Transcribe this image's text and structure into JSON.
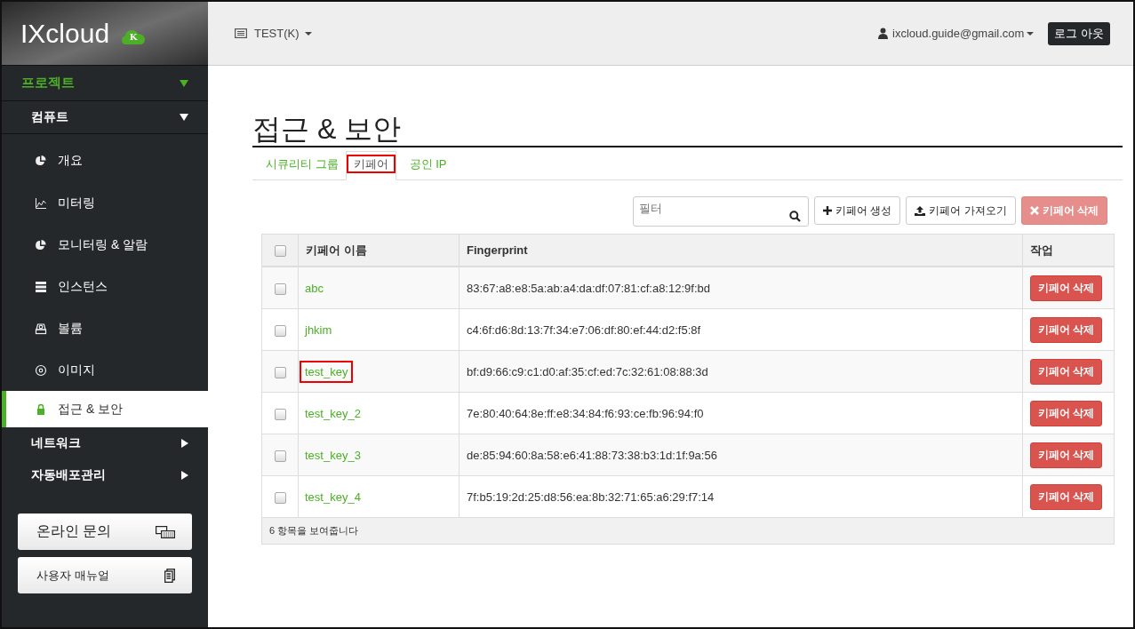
{
  "logo": {
    "text": "IXcloud",
    "badge": "K"
  },
  "header": {
    "project": "TEST(K)",
    "user": "ixcloud.guide@gmail.com",
    "logout": "로그 아웃"
  },
  "sidebar": {
    "sections": [
      {
        "label": "프로젝트",
        "expanded": true,
        "children": [
          {
            "label": "컴퓨트",
            "expanded": true,
            "children": [
              {
                "label": "개요",
                "selected": false
              },
              {
                "label": "미터링",
                "selected": false
              },
              {
                "label": "모니터링 & 알람",
                "selected": false
              },
              {
                "label": "인스턴스",
                "selected": false
              },
              {
                "label": "볼륨",
                "selected": false
              },
              {
                "label": "이미지",
                "selected": false
              },
              {
                "label": "접근 & 보안",
                "selected": true
              }
            ]
          },
          {
            "label": "네트워크",
            "expanded": false
          },
          {
            "label": "자동배포관리",
            "expanded": false
          }
        ]
      }
    ],
    "buttons": [
      "온라인 문의",
      "사용자 매뉴얼"
    ]
  },
  "page": {
    "title": "접근 & 보안",
    "tabs": [
      {
        "label": "시큐리티 그룹",
        "selected": false,
        "highlighted": false
      },
      {
        "label": "키페어",
        "selected": true,
        "highlighted": true
      },
      {
        "label": "공인 IP",
        "selected": false,
        "highlighted": false
      }
    ],
    "filter": {
      "placeholder": "필터"
    },
    "actions": [
      {
        "label": "키페어 생성",
        "kind": "create",
        "disabled": false
      },
      {
        "label": "키페어 가져오기",
        "kind": "import",
        "disabled": false
      },
      {
        "label": "키페어 삭제",
        "kind": "delete",
        "disabled": true
      }
    ],
    "table": {
      "select_all_checked": false,
      "columns": [
        "키페어 이름",
        "Fingerprint",
        "작업"
      ],
      "rows": [
        {
          "name": "abc",
          "fingerprint": "83:67:a8:e8:5a:ab:a4:da:df:07:81:cf:a8:12:9f:bd",
          "action": "키페어 삭제",
          "checked": false,
          "highlighted": false
        },
        {
          "name": "jhkim",
          "fingerprint": "c4:6f:d6:8d:13:7f:34:e7:06:df:80:ef:44:d2:f5:8f",
          "action": "키페어 삭제",
          "checked": false,
          "highlighted": false
        },
        {
          "name": "test_key",
          "fingerprint": "bf:d9:66:c9:c1:d0:af:35:cf:ed:7c:32:61:08:88:3d",
          "action": "키페어 삭제",
          "checked": false,
          "highlighted": true
        },
        {
          "name": "test_key_2",
          "fingerprint": "7e:80:40:64:8e:ff:e8:34:84:f6:93:ce:fb:96:94:f0",
          "action": "키페어 삭제",
          "checked": false,
          "highlighted": false
        },
        {
          "name": "test_key_3",
          "fingerprint": "de:85:94:60:8a:58:e6:41:88:73:38:b3:1d:1f:9a:56",
          "action": "키페어 삭제",
          "checked": false,
          "highlighted": false
        },
        {
          "name": "test_key_4",
          "fingerprint": "7f:b5:19:2d:25:d8:56:ea:8b:32:71:65:a6:29:f7:14",
          "action": "키페어 삭제",
          "checked": false,
          "highlighted": false
        }
      ],
      "footer": "6 항목을 보여줍니다"
    }
  }
}
